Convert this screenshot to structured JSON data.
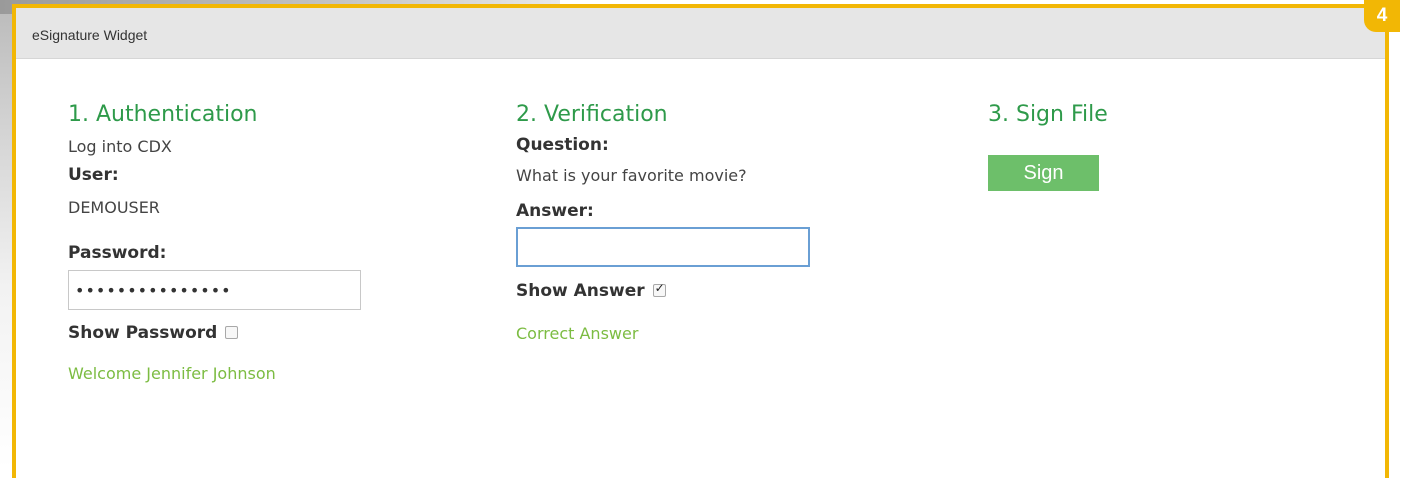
{
  "badge": {
    "number": "4"
  },
  "widget": {
    "title": "eSignature Widget"
  },
  "authentication": {
    "heading": "1. Authentication",
    "subtitle": "Log into CDX",
    "user_label": "User:",
    "user_value": "DEMOUSER",
    "password_label": "Password:",
    "password_value": "•••••••••••••••",
    "show_password_label": "Show Password",
    "show_password_checked": false,
    "welcome_message": "Welcome Jennifer Johnson"
  },
  "verification": {
    "heading": "2. Verification",
    "question_label": "Question:",
    "question_text": "What is your favorite movie?",
    "answer_label": "Answer:",
    "answer_value": "",
    "show_answer_label": "Show Answer",
    "show_answer_checked": true,
    "result_message": "Correct Answer"
  },
  "sign_file": {
    "heading": "3. Sign File",
    "sign_button_label": "Sign"
  },
  "colors": {
    "frame_border": "#f2b705",
    "heading_green": "#2e9a4a",
    "message_green": "#7cbc42",
    "button_green": "#6dbf6a",
    "input_focus_border": "#6a9fd4"
  }
}
